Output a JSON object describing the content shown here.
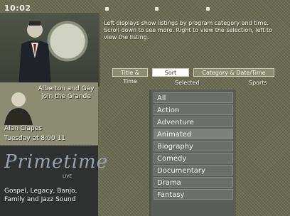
{
  "topbar": {
    "clock": "10:02"
  },
  "promo_ad": {
    "text": "Alberton and Gay join the Grande",
    "name": "Alan Clapes",
    "date": "Tuesday at 8:00 11"
  },
  "logo": {
    "title": "Primetime",
    "subtitle": "LIVE",
    "caption": "Gospel, Legacy, Banjo, Family and Jazz Sound"
  },
  "instruction": "Left displays show listings by program category and time. Scroll down to see more. Right to view the selection, left to view the listing.",
  "modes": {
    "items": [
      {
        "label": "Title & Time"
      },
      {
        "label": "Sort"
      },
      {
        "label": "Category & Date/Time"
      }
    ],
    "selected_index": 1
  },
  "columns": {
    "left": "Selected",
    "right": "Sports"
  },
  "genres": {
    "items": [
      {
        "label": "All"
      },
      {
        "label": "Action"
      },
      {
        "label": "Adventure"
      },
      {
        "label": "Animated"
      },
      {
        "label": "Biography"
      },
      {
        "label": "Comedy"
      },
      {
        "label": "Documentary"
      },
      {
        "label": "Drama"
      },
      {
        "label": "Fantasy"
      }
    ]
  }
}
